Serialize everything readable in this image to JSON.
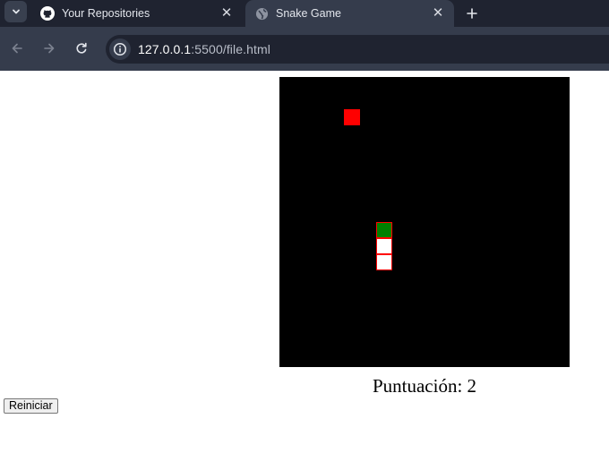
{
  "browser": {
    "tabs": [
      {
        "title": "Your Repositories",
        "favicon": "github-icon",
        "active": false
      },
      {
        "title": "Snake Game",
        "favicon": "globe-icon",
        "active": true
      }
    ],
    "url": {
      "host": "127.0.0.1",
      "rest": ":5500/file.html"
    },
    "colors": {
      "tabstrip": "#1f2330",
      "toolbar": "#353c4c"
    }
  },
  "game": {
    "grid": {
      "cells": 18
    },
    "food": {
      "col": 4,
      "row": 2,
      "color": "#ff0000"
    },
    "snake": [
      {
        "col": 6,
        "row": 9,
        "color": "#008000",
        "role": "head"
      },
      {
        "col": 6,
        "row": 10,
        "color": "#ffffff",
        "role": "body"
      },
      {
        "col": 6,
        "row": 11,
        "color": "#ffffff",
        "role": "body"
      }
    ],
    "segment_border_color": "#ff0000",
    "board_color": "#000000",
    "score_text": "Puntuación: 2",
    "score": 2,
    "restart_label": "Reiniciar"
  }
}
